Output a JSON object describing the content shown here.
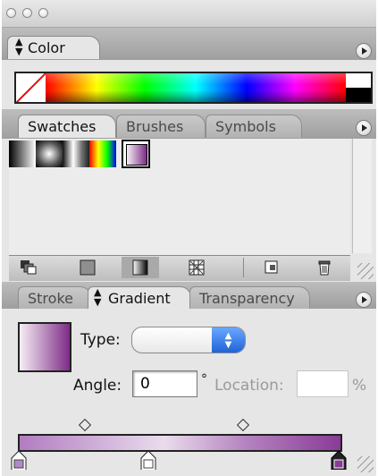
{
  "window": {
    "traffic_lights": [
      "close",
      "minimize",
      "zoom"
    ]
  },
  "color_panel": {
    "tab": "Color",
    "tab_icon": "up-down-arrows-icon",
    "menu_icon": "panel-menu-arrow-icon",
    "ramp": {
      "none_chip": "none-swatch-icon",
      "colors": {
        "none_slash": "#e01010",
        "black": "#000000",
        "white": "#ffffff"
      }
    }
  },
  "swatch_panel": {
    "tabs": [
      "Swatches",
      "Brushes",
      "Symbols"
    ],
    "swatches": [
      {
        "name": "linear-black-white",
        "colors": [
          "#000000",
          "#ffffff"
        ]
      },
      {
        "name": "radial-black-white",
        "colors": [
          "#ffffff",
          "#000000"
        ]
      },
      {
        "name": "linear-grays",
        "colors": [
          "#111111",
          "#ffffff",
          "#555555"
        ]
      },
      {
        "name": "rainbow",
        "colors": [
          "#ff0000",
          "#ffff00",
          "#00ff00",
          "#0000ff"
        ]
      },
      {
        "name": "purple-gradient",
        "colors": [
          "#f6eef6",
          "#7d2c86"
        ],
        "selected": true
      }
    ],
    "buttons": [
      "show-swatch-kinds-icon",
      "show-color-swatches-icon",
      "show-gradient-swatches-icon",
      "show-pattern-swatches-icon",
      "new-swatch-icon",
      "delete-swatch-icon"
    ]
  },
  "gradient_panel": {
    "tabs": [
      "Stroke",
      "Gradient",
      "Transparency"
    ],
    "active_tab": "Gradient",
    "type_label": "Type:",
    "type_value": "",
    "angle_label": "Angle:",
    "angle_value": "0",
    "degree_symbol": "°",
    "location_label": "Location:",
    "location_value": "",
    "percent_symbol": "%",
    "stops": [
      {
        "position": 0,
        "color": "#b08ac4"
      },
      {
        "position": 0.4,
        "color": "#ffffff"
      },
      {
        "position": 1,
        "color": "#8a3b97"
      }
    ],
    "midpoints": [
      0.2,
      0.7
    ]
  }
}
